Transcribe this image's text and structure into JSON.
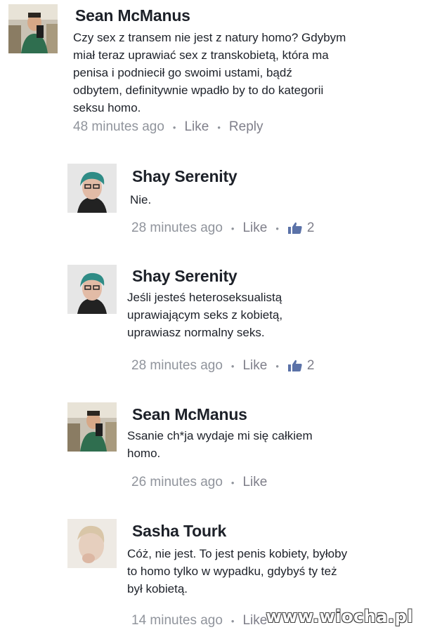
{
  "comments": [
    {
      "author": "Sean McManus",
      "text": "Czy  sex z transem nie jest z natury homo? Gdybym\nmiał teraz uprawiać sex z transkobietą, która ma\npenisa i podniecił go swoimi ustami, bądź\nodbytem, definitywnie wpadło by to do kategorii\nseksu homo.",
      "time": "48 minutes ago",
      "like_label": "Like",
      "reply_label": "Reply"
    },
    {
      "author": "Shay Serenity",
      "text": "Nie.",
      "time": "28 minutes ago",
      "like_label": "Like",
      "likes": "2"
    },
    {
      "author": "Shay Serenity",
      "text": "Jeśli jesteś heteroseksualistą\nuprawiającym seks z kobietą,\nuprawiasz normalny seks.",
      "time": "28 minutes ago",
      "like_label": "Like",
      "likes": "2"
    },
    {
      "author": "Sean McManus",
      "text": "Ssanie ch*ja wydaje mi się całkiem\nhomo.",
      "time": "26 minutes ago",
      "like_label": "Like"
    },
    {
      "author": "Sasha Tourk",
      "text": "Cóż, nie jest. To jest penis kobiety, byłoby\nto homo tylko w wypadku, gdybyś ty też\nbył kobietą.",
      "time": "14 minutes ago",
      "like_label": "Like"
    }
  ],
  "watermark": "www.wiocha.pl",
  "colors": {
    "name": "#1d2129",
    "meta": "#90949c",
    "like_icon": "#5b72a8"
  }
}
